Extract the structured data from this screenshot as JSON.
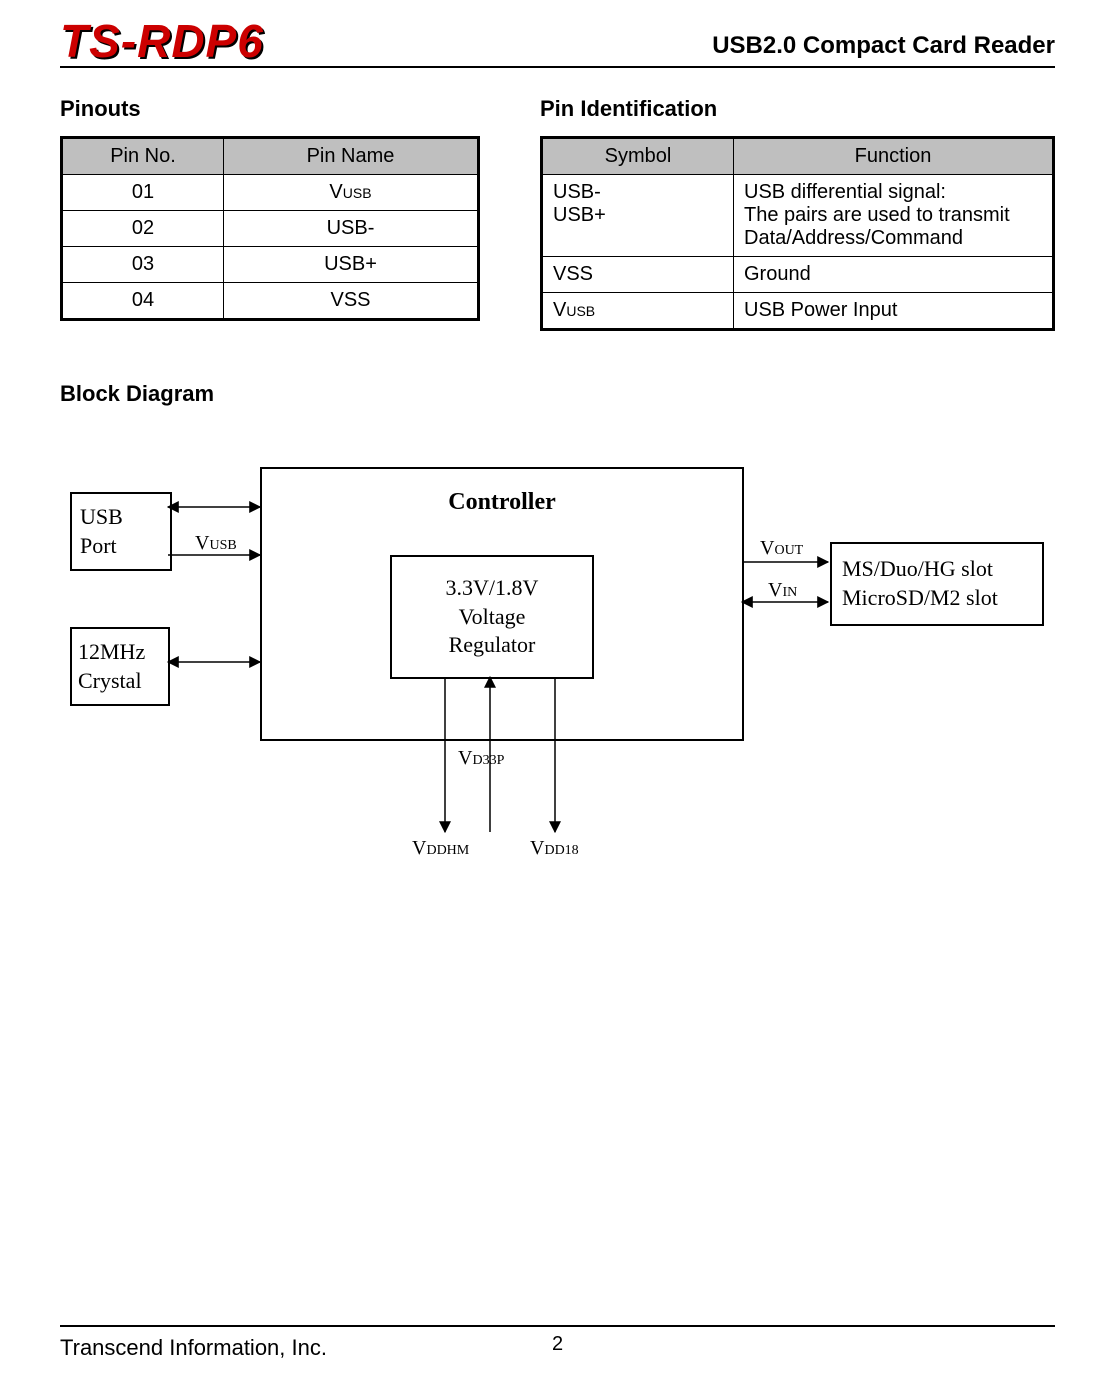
{
  "header": {
    "brand": "TS-RDP6",
    "product": "USB2.0 Compact Card Reader"
  },
  "sections": {
    "pinouts_title": "Pinouts",
    "pinid_title": "Pin Identification",
    "block_title": "Block Diagram"
  },
  "pinouts": {
    "headers": {
      "no": "Pin No.",
      "name": "Pin Name"
    },
    "rows": [
      {
        "no": "01",
        "name_prefix": "V",
        "name_sub": "USB",
        "name_suffix": ""
      },
      {
        "no": "02",
        "name_prefix": "USB-",
        "name_sub": "",
        "name_suffix": ""
      },
      {
        "no": "03",
        "name_prefix": "USB+",
        "name_sub": "",
        "name_suffix": ""
      },
      {
        "no": "04",
        "name_prefix": "VSS",
        "name_sub": "",
        "name_suffix": ""
      }
    ]
  },
  "pinid": {
    "headers": {
      "symbol": "Symbol",
      "function": "Function"
    },
    "rows": [
      {
        "symbol_l1": "USB-",
        "symbol_l2": "USB+",
        "func_l1": "USB differential signal:",
        "func_l2": "The pairs are used to transmit",
        "func_l3": "Data/Address/Command"
      },
      {
        "symbol": "VSS",
        "function": "Ground"
      },
      {
        "symbol_prefix": "V",
        "symbol_sub": "USB",
        "function": "USB Power Input"
      }
    ]
  },
  "diagram": {
    "usb_port_l1": "USB",
    "usb_port_l2": "Port",
    "crystal_l1": "12MHz",
    "crystal_l2": "Crystal",
    "controller": "Controller",
    "vr_l1": "3.3V/1.8V",
    "vr_l2": "Voltage",
    "vr_l3": "Regulator",
    "slots_l1": "MS/Duo/HG slot",
    "slots_l2": "MicroSD/M2 slot",
    "vusb_prefix": "V",
    "vusb_sub": "USB",
    "vout_prefix": "V",
    "vout_sub": "OUT",
    "vin_prefix": "V",
    "vin_sub": "IN",
    "vd33p_prefix": "V",
    "vd33p_sub": "D33P",
    "vddhm_prefix": "V",
    "vddhm_sub": "DDHM",
    "vdd18_prefix": "V",
    "vdd18_sub": "DD18"
  },
  "footer": {
    "company": "Transcend Information, Inc.",
    "page": "2"
  }
}
